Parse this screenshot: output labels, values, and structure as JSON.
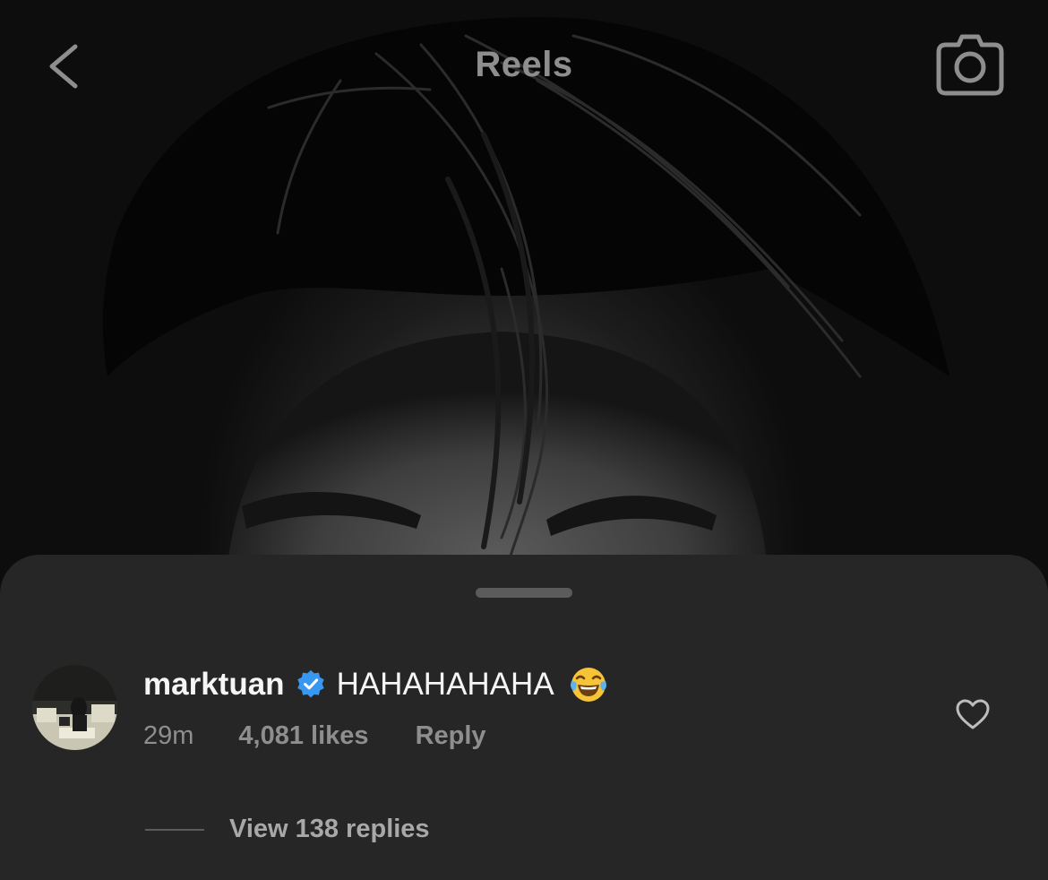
{
  "header": {
    "title": "Reels",
    "back_icon": "chevron-left-icon",
    "camera_icon": "camera-icon"
  },
  "comment": {
    "username": "marktuan",
    "verified": true,
    "text": "HAHAHAHAHA",
    "emoji": "face-with-tears-of-joy",
    "time": "29m",
    "likes": "4,081 likes",
    "reply_label": "Reply",
    "view_replies_label": "View 138 replies",
    "like_icon": "heart-outline-icon"
  },
  "colors": {
    "sheet_background": "#262626",
    "primary_text": "#f5f5f5",
    "secondary_text": "#8e8e8e",
    "verified_badge": "#3897f0"
  }
}
